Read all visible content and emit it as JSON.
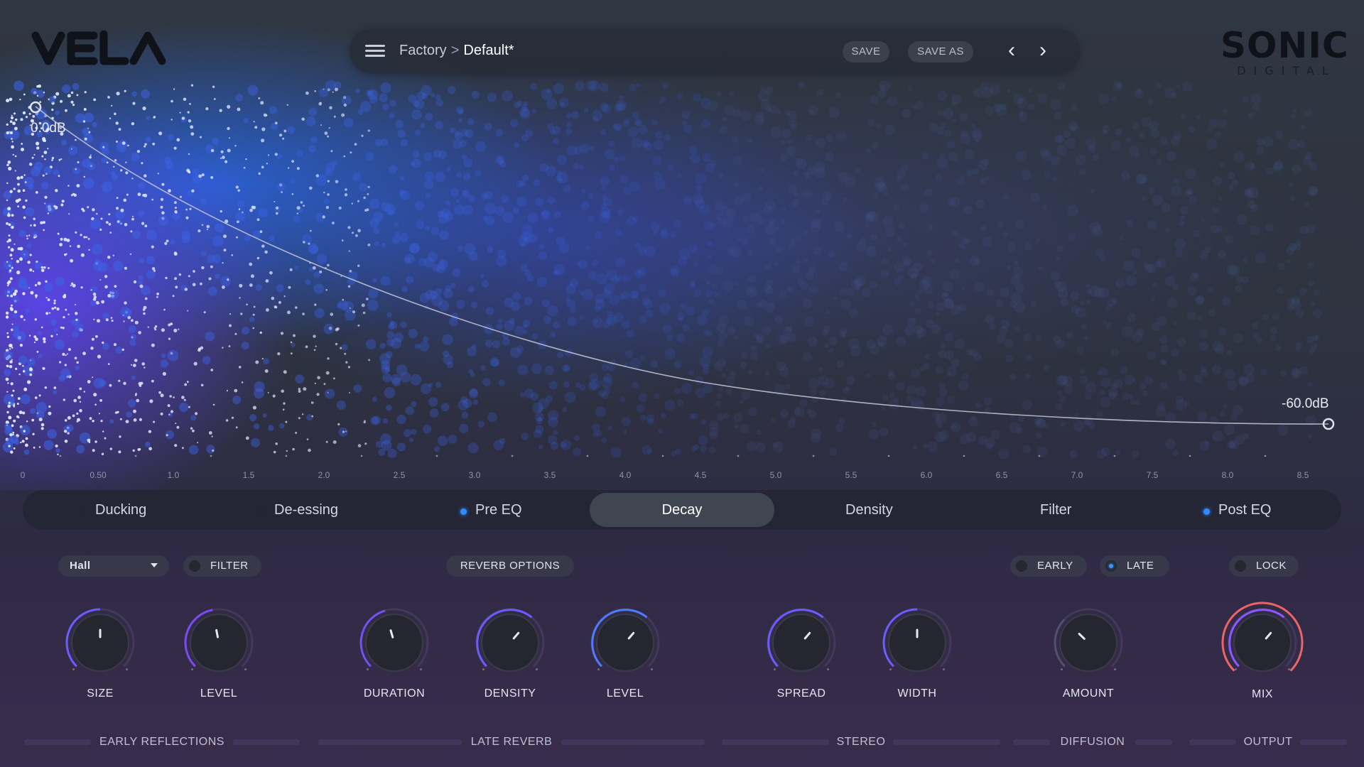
{
  "app": {
    "logo": "VELA",
    "brand_top": "SONIC",
    "brand_bottom": "DIGITAL"
  },
  "preset": {
    "bank": "Factory",
    "separator": ">",
    "name": "Default*",
    "save_label": "SAVE",
    "save_as_label": "SAVE AS"
  },
  "decay": {
    "start_label": "0.0dB",
    "end_label": "-60.0dB",
    "ticks": [
      "0",
      "0.50",
      "1.0",
      "1.5",
      "2.0",
      "2.5",
      "3.0",
      "3.5",
      "4.0",
      "4.5",
      "5.0",
      "5.5",
      "6.0",
      "6.5",
      "7.0",
      "7.5",
      "8.0",
      "8.5"
    ]
  },
  "tabs": [
    {
      "label": "Ducking",
      "dot": "off"
    },
    {
      "label": "De-essing",
      "dot": "off"
    },
    {
      "label": "Pre EQ",
      "dot": "on"
    },
    {
      "label": "Decay",
      "active": true
    },
    {
      "label": "Density"
    },
    {
      "label": "Filter"
    },
    {
      "label": "Post EQ",
      "dot": "on"
    }
  ],
  "controls": {
    "room_type": "Hall",
    "filter_label": "FILTER",
    "reverb_options_label": "REVERB OPTIONS",
    "early_label": "EARLY",
    "late_label": "LATE",
    "lock_label": "LOCK"
  },
  "knobs": [
    {
      "label": "SIZE",
      "value": 0.5
    },
    {
      "label": "LEVEL",
      "value": 0.46
    },
    {
      "label": "DURATION",
      "value": 0.44
    },
    {
      "label": "DENSITY",
      "value": 0.65
    },
    {
      "label": "LEVEL",
      "value": 0.65
    },
    {
      "label": "SPREAD",
      "value": 0.65
    },
    {
      "label": "WIDTH",
      "value": 0.5
    },
    {
      "label": "AMOUNT",
      "value": 0.33
    },
    {
      "label": "MIX",
      "value": 0.65
    }
  ],
  "sections": [
    "EARLY REFLECTIONS",
    "LATE REVERB",
    "STEREO",
    "DIFFUSION",
    "OUTPUT"
  ],
  "colors": {
    "accent": "#2f8cff",
    "mix_ring": "#ff6b6b"
  }
}
